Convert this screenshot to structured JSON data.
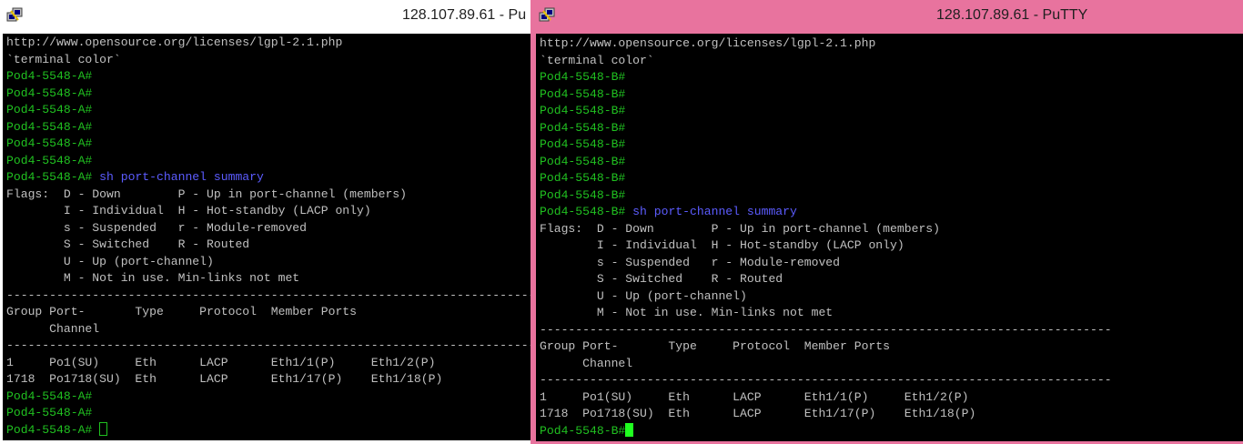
{
  "window_a": {
    "title": "128.107.89.61 - Pu",
    "lines": [
      {
        "text": "http://www.opensource.org/licenses/lgpl-2.1.php",
        "type": "plain"
      },
      {
        "text": "`terminal color`",
        "type": "plain"
      },
      {
        "text": "Pod4-5548-A#",
        "type": "prompt"
      },
      {
        "text": "Pod4-5548-A#",
        "type": "prompt"
      },
      {
        "text": "Pod4-5548-A#",
        "type": "prompt"
      },
      {
        "text": "Pod4-5548-A#",
        "type": "prompt"
      },
      {
        "text": "Pod4-5548-A#",
        "type": "prompt"
      },
      {
        "text": "Pod4-5548-A#",
        "type": "prompt"
      },
      {
        "text": "Pod4-5548-A#",
        "type": "prompt",
        "cmd": " sh port-channel summary"
      },
      {
        "text": "Flags:  D - Down        P - Up in port-channel (members)",
        "type": "plain"
      },
      {
        "text": "        I - Individual  H - Hot-standby (LACP only)",
        "type": "plain"
      },
      {
        "text": "        s - Suspended   r - Module-removed",
        "type": "plain"
      },
      {
        "text": "        S - Switched    R - Routed",
        "type": "plain"
      },
      {
        "text": "        U - Up (port-channel)",
        "type": "plain"
      },
      {
        "text": "        M - Not in use. Min-links not met",
        "type": "plain"
      },
      {
        "text": "--------------------------------------------------------------------------------",
        "type": "plain"
      },
      {
        "text": "Group Port-       Type     Protocol  Member Ports",
        "type": "plain"
      },
      {
        "text": "      Channel",
        "type": "plain"
      },
      {
        "text": "--------------------------------------------------------------------------------",
        "type": "plain"
      },
      {
        "text": "1     Po1(SU)     Eth      LACP      Eth1/1(P)     Eth1/2(P)",
        "type": "plain"
      },
      {
        "text": "1718  Po1718(SU)  Eth      LACP      Eth1/17(P)    Eth1/18(P)",
        "type": "plain"
      },
      {
        "text": "Pod4-5548-A#",
        "type": "prompt"
      },
      {
        "text": "Pod4-5548-A#",
        "type": "prompt"
      },
      {
        "text": "Pod4-5548-A# ",
        "type": "prompt",
        "cursor": "hollow"
      }
    ]
  },
  "window_b": {
    "title": "128.107.89.61 - PuTTY",
    "lines": [
      {
        "text": "http://www.opensource.org/licenses/lgpl-2.1.php",
        "type": "plain"
      },
      {
        "text": "`terminal color`",
        "type": "plain"
      },
      {
        "text": "Pod4-5548-B#",
        "type": "prompt"
      },
      {
        "text": "Pod4-5548-B#",
        "type": "prompt"
      },
      {
        "text": "Pod4-5548-B#",
        "type": "prompt"
      },
      {
        "text": "Pod4-5548-B#",
        "type": "prompt"
      },
      {
        "text": "Pod4-5548-B#",
        "type": "prompt"
      },
      {
        "text": "Pod4-5548-B#",
        "type": "prompt"
      },
      {
        "text": "Pod4-5548-B#",
        "type": "prompt"
      },
      {
        "text": "Pod4-5548-B#",
        "type": "prompt"
      },
      {
        "text": "Pod4-5548-B#",
        "type": "prompt",
        "cmd": " sh port-channel summary"
      },
      {
        "text": "Flags:  D - Down        P - Up in port-channel (members)",
        "type": "plain"
      },
      {
        "text": "        I - Individual  H - Hot-standby (LACP only)",
        "type": "plain"
      },
      {
        "text": "        s - Suspended   r - Module-removed",
        "type": "plain"
      },
      {
        "text": "        S - Switched    R - Routed",
        "type": "plain"
      },
      {
        "text": "        U - Up (port-channel)",
        "type": "plain"
      },
      {
        "text": "        M - Not in use. Min-links not met",
        "type": "plain"
      },
      {
        "text": "--------------------------------------------------------------------------------",
        "type": "plain"
      },
      {
        "text": "Group Port-       Type     Protocol  Member Ports",
        "type": "plain"
      },
      {
        "text": "      Channel",
        "type": "plain"
      },
      {
        "text": "--------------------------------------------------------------------------------",
        "type": "plain"
      },
      {
        "text": "1     Po1(SU)     Eth      LACP      Eth1/1(P)     Eth1/2(P)",
        "type": "plain"
      },
      {
        "text": "1718  Po1718(SU)  Eth      LACP      Eth1/17(P)    Eth1/18(P)",
        "type": "plain"
      },
      {
        "text": "Pod4-5548-B#",
        "type": "prompt",
        "cursor": "solid"
      }
    ]
  },
  "icons": {
    "app": "putty-icon"
  },
  "colors": {
    "active_titlebar": "#e8739e",
    "prompt": "#20c020",
    "command": "#5c5cff",
    "terminal_bg": "#000000",
    "terminal_fg": "#c0c0c0"
  }
}
